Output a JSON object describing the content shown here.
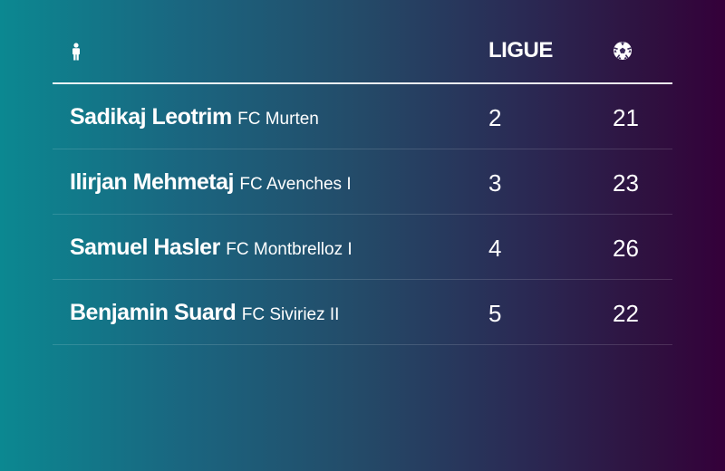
{
  "table": {
    "header": {
      "player_icon": "person-icon",
      "league_label": "LIGUE",
      "goals_icon": "soccer-ball-icon"
    },
    "rows": [
      {
        "player": "Sadikaj Leotrim",
        "club": "FC Murten",
        "league": "2",
        "goals": "21"
      },
      {
        "player": "Ilirjan Mehmetaj",
        "club": "FC Avenches I",
        "league": "3",
        "goals": "23"
      },
      {
        "player": "Samuel Hasler",
        "club": "FC Montbrelloz I",
        "league": "4",
        "goals": "26"
      },
      {
        "player": "Benjamin Suard",
        "club": "FC Siviriez II",
        "league": "5",
        "goals": "22"
      }
    ]
  },
  "colors": {
    "gradient_start": "#0b8891",
    "gradient_end": "#34003a",
    "text": "#ffffff"
  }
}
